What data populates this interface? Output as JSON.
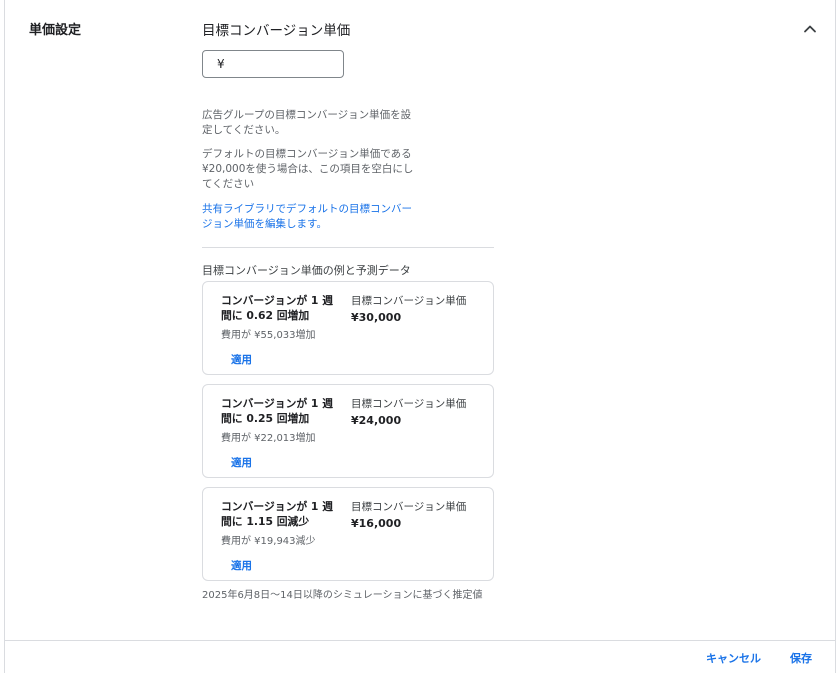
{
  "section": {
    "label": "単価設定"
  },
  "field": {
    "title": "目標コンバージョン単価",
    "currency_prefix": "¥",
    "value": ""
  },
  "help": {
    "line1": "広告グループの目標コンバージョン単価を設定してください。",
    "line2": "デフォルトの目標コンバージョン単価である ¥20,000を使う場合は、この項目を空白にしてください",
    "link": "共有ライブラリでデフォルトの目標コンバージョン単価を編集します。"
  },
  "examples": {
    "heading": "目標コンバージョン単価の例と予測データ",
    "cards": [
      {
        "conversion_change": "コンバージョンが 1 週間に 0.62 回増加",
        "cost_change": "費用が ¥55,033増加",
        "cpa_label": "目標コンバージョン単価",
        "cpa_value": "¥30,000",
        "apply_label": "適用"
      },
      {
        "conversion_change": "コンバージョンが 1 週間に 0.25 回増加",
        "cost_change": "費用が ¥22,013増加",
        "cpa_label": "目標コンバージョン単価",
        "cpa_value": "¥24,000",
        "apply_label": "適用"
      },
      {
        "conversion_change": "コンバージョンが 1 週間に 1.15 回減少",
        "cost_change": "費用が ¥19,943減少",
        "cpa_label": "目標コンバージョン単価",
        "cpa_value": "¥16,000",
        "apply_label": "適用"
      }
    ],
    "footnote": "2025年6月8日〜14日以降のシミュレーションに基づく推定値"
  },
  "footer": {
    "cancel_label": "キャンセル",
    "save_label": "保存"
  },
  "icons": {
    "collapse": "chevron-up-icon"
  },
  "colors": {
    "link": "#1a73e8",
    "border": "#dadce0",
    "text": "#202124"
  }
}
